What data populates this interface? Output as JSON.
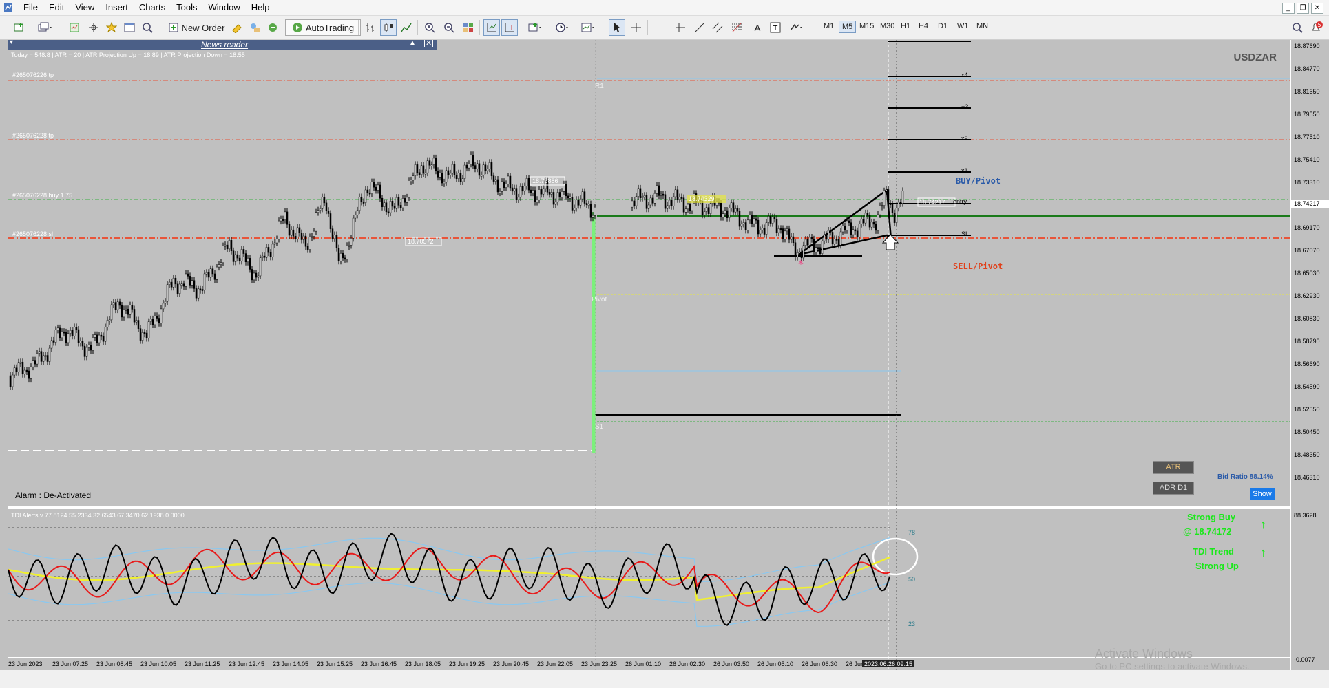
{
  "menu": {
    "items": [
      "File",
      "Edit",
      "View",
      "Insert",
      "Charts",
      "Tools",
      "Window",
      "Help"
    ]
  },
  "toolbar": {
    "new_order": "New Order",
    "auto_trading": "AutoTrading",
    "timeframes": [
      "M1",
      "M5",
      "M15",
      "M30",
      "H1",
      "H4",
      "D1",
      "W1",
      "MN"
    ],
    "active_timeframe": "M5",
    "notification_count": "5"
  },
  "news_reader": {
    "title": "News reader"
  },
  "chart": {
    "symbol": "USDZAR",
    "info_line": "Today = 548.8   |   ATR = 20   |   ATR Projection Up = 18.89   |   ATR Projection Down = 18.55",
    "order_tp1": "#265076226 tp",
    "order_tp2": "#265076228 tp",
    "order_buy": "#265076228 buy 1.75",
    "order_sl": "#265076228 sl",
    "label_r1": "R1",
    "label_pivot": "Pivot",
    "label_s1": "S1",
    "price_tag1": "18.75886",
    "price_tag2": "18.70572",
    "price_tag3": "18.74329",
    "price_tag4": "18.74217",
    "level_x4": "x4",
    "level_3": "+3",
    "level_x2": "x2",
    "level_x1": "x1",
    "level_entry": "entry",
    "level_sl": "SL",
    "buy_pivot": "BUY/Pivot",
    "sell_pivot": "SELL/Pivot",
    "alarm": "Alarm : De-Activated",
    "atr_button": "ATR",
    "adr_button": "ADR D1",
    "bid_ratio": "Bid Ratio 88.14%",
    "show_button": "Show"
  },
  "indicator": {
    "title": "TDI Alerts v 77.8124 55.2334 32.6543 67.3470 62.1938 0.0000",
    "level_78": "78",
    "level_50": "50",
    "level_23": "23",
    "strong_buy": "Strong Buy",
    "strong_buy_price": "@ 18.74172",
    "tdi_trend": "TDI Trend",
    "strong_up": "Strong Up",
    "axis_top": "88.3628",
    "axis_bottom": "-0.0077"
  },
  "price_axis": [
    "18.87690",
    "18.84770",
    "18.81650",
    "18.79550",
    "18.77510",
    "18.75410",
    "18.73310",
    "18.71270",
    "18.69170",
    "18.67070",
    "18.65030",
    "18.62930",
    "18.60830",
    "18.58790",
    "18.56690",
    "18.54590",
    "18.52550",
    "18.50450",
    "18.48350",
    "18.46310"
  ],
  "current_price": "18.74217",
  "time_axis": [
    "23 Jun 2023",
    "23 Jun 07:25",
    "23 Jun 08:45",
    "23 Jun 10:05",
    "23 Jun 11:25",
    "23 Jun 12:45",
    "23 Jun 14:05",
    "23 Jun 15:25",
    "23 Jun 16:45",
    "23 Jun 18:05",
    "23 Jun 19:25",
    "23 Jun 20:45",
    "23 Jun 22:05",
    "23 Jun 23:25",
    "26 Jun 01:10",
    "26 Jun 02:30",
    "26 Jun 03:50",
    "26 Jun 05:10",
    "26 Jun 06:30",
    "26 Jun 07:50"
  ],
  "cursor_time": "2023.06.26 09:15",
  "watermark": {
    "line1": "Activate Windows",
    "line2": "Go to PC settings to activate Windows."
  }
}
